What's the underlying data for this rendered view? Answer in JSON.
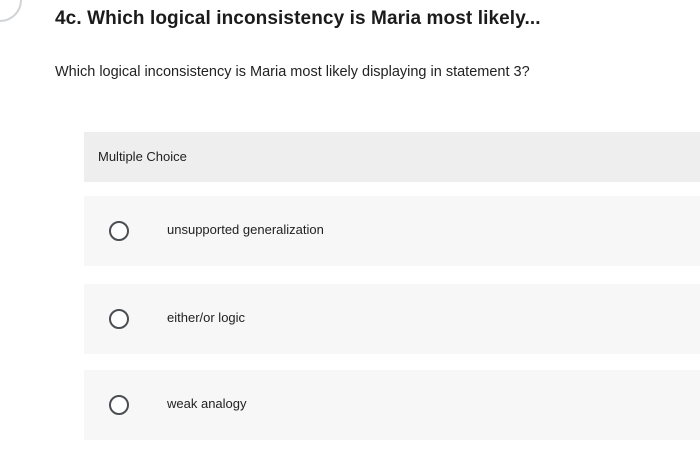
{
  "question": {
    "title": "4c. Which logical inconsistency is Maria most likely...",
    "text": "Which logical inconsistency is Maria most likely displaying in statement 3?"
  },
  "answer_area": {
    "type_label": "Multiple Choice",
    "options": [
      {
        "label": "unsupported generalization",
        "icon": "radio-empty-icon",
        "selected": false
      },
      {
        "label": "either/or logic",
        "icon": "radio-empty-icon",
        "selected": false
      },
      {
        "label": "weak analogy",
        "icon": "radio-empty-icon",
        "selected": false
      }
    ]
  },
  "colors": {
    "header_bg": "#eeeeef",
    "option_bg": "#f7f7f7",
    "radio_border": "#4b4f53",
    "text": "#1b1b1b"
  }
}
